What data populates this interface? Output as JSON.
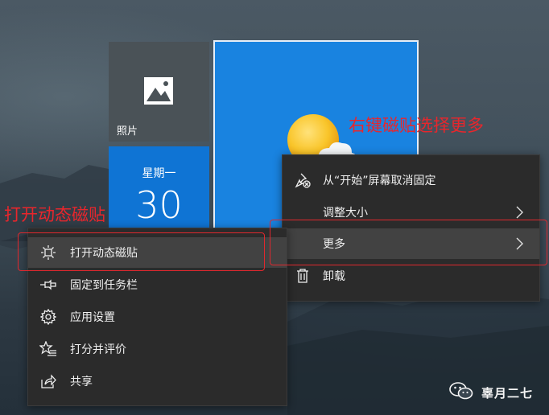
{
  "tiles": {
    "photos": {
      "label": "照片",
      "icon": "image-icon"
    },
    "calendar": {
      "day": "星期一",
      "date": "30"
    },
    "weather": {
      "icon": "weather-partly-sunny-icon"
    }
  },
  "more_menu": {
    "items": [
      {
        "label": "从“开始”屏幕取消固定",
        "icon": "unpin-icon"
      },
      {
        "label": "调整大小",
        "icon": "",
        "has_submenu": true
      },
      {
        "label": "更多",
        "icon": "",
        "has_submenu": true,
        "highlighted": true
      },
      {
        "label": "卸载",
        "icon": "trash-icon"
      }
    ]
  },
  "submenu": {
    "items": [
      {
        "label": "打开动态磁贴",
        "icon": "live-tile-icon",
        "highlighted": true
      },
      {
        "label": "固定到任务栏",
        "icon": "pin-icon"
      },
      {
        "label": "应用设置",
        "icon": "gear-icon"
      },
      {
        "label": "打分并评价",
        "icon": "star-list-icon"
      },
      {
        "label": "共享",
        "icon": "share-icon"
      }
    ]
  },
  "annotations": {
    "right_click_note": "右键磁贴选择更多",
    "open_live_tile_note": "打开动态磁贴"
  },
  "watermark": {
    "text": "辜月二七",
    "icon": "wechat-icon"
  },
  "colors": {
    "annotation": "#e8262c",
    "tile_blue": "#1983e0",
    "calendar_blue": "#0f74d4",
    "menu_bg": "#2b2b2b",
    "menu_highlight": "#424242"
  }
}
